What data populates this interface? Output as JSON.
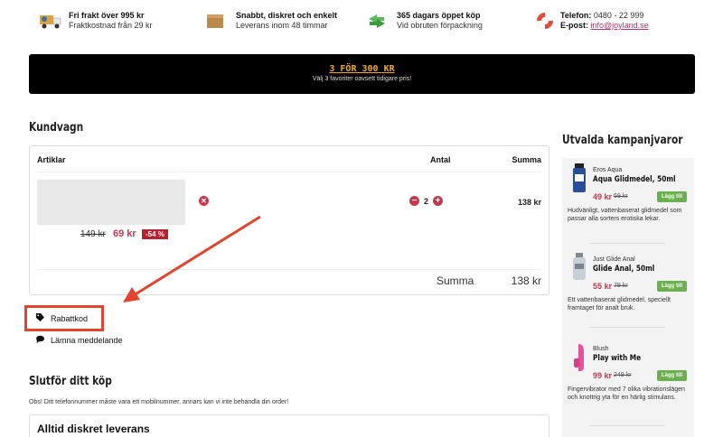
{
  "usps": [
    {
      "icon": "delivery-truck-icon",
      "title": "Fri frakt över 995 kr",
      "sub": "Fraktkostnad från 29 kr"
    },
    {
      "icon": "package-box-icon",
      "title": "Snabbt, diskret och enkelt",
      "sub": "Leverans inom 48 timmar"
    },
    {
      "icon": "return-arrows-icon",
      "title": "365 dagars öppet köp",
      "sub": "Vid obruten förpackning"
    },
    {
      "icon": "lifebuoy-icon",
      "phone_label": "Telefon:",
      "phone": "0480 - 22 999",
      "email_label": "E-post:",
      "email": "info@joyland.se"
    }
  ],
  "banner": {
    "headline": "3 FÖR 300 KR",
    "sub": "Välj 3 favoriter oavsett tidigare pris!"
  },
  "cart": {
    "title": "Kundvagn",
    "col_articles": "Artiklar",
    "col_qty": "Antal",
    "col_sum": "Summa",
    "item": {
      "old_price": "149 kr",
      "price": "69 kr",
      "discount": "-54 %",
      "qty": "2",
      "sum": "138 kr"
    },
    "total_label": "Summa",
    "total_value": "138 kr"
  },
  "links": {
    "coupon": "Rabattkod",
    "message": "Lämna meddelande"
  },
  "checkout": {
    "title": "Slutför ditt köp",
    "note": "Obs! Ditt telefonnummer måste vara ett mobilnummer, annars kan vi inte behandla din order!",
    "box_title": "Alltid diskret leverans"
  },
  "sidebar": {
    "title": "Utvalda kampanjvaror",
    "products": [
      {
        "brand": "Eros Aqua",
        "name": "Aqua Glidmedel, 50ml",
        "price": "49 kr",
        "old": "69 kr",
        "add": "Lägg till",
        "desc": "Hudvänligt, vattenbaserat glidmedel som passar alla sorters erotiska lekar.",
        "thumb_color": "#2a4f9a"
      },
      {
        "brand": "Just Glide Anal",
        "name": "Glide Anal, 50ml",
        "price": "55 kr",
        "old": "79 kr",
        "add": "Lägg till",
        "desc": "Ett vattenbaserat glidmedel, speciellt framtaget för analt bruk.",
        "thumb_color": "#9aa3ad"
      },
      {
        "brand": "Blush",
        "name": "Play with Me",
        "price": "99 kr",
        "old": "249 kr",
        "add": "Lägg till",
        "desc": "Fingervibrator med 7 olika vibrationslägen och knottrig yta för en härlig stimulans.",
        "thumb_color": "#e8509a"
      }
    ]
  },
  "colors": {
    "accent": "#c9374f",
    "add_button": "#6ab04c",
    "annotation": "#e2442d",
    "banner_text": "#f5a623"
  }
}
